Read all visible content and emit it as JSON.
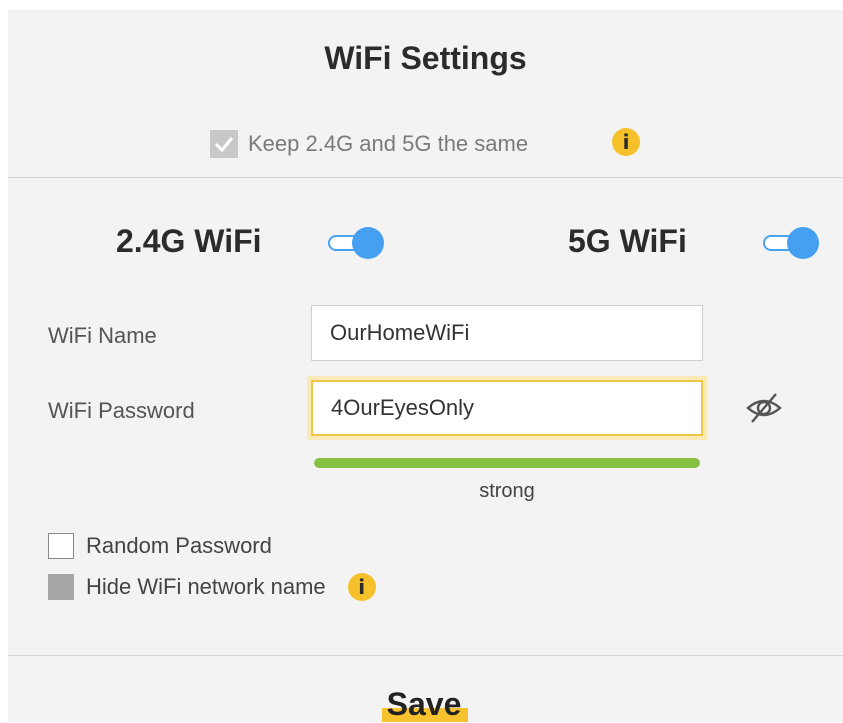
{
  "header": {
    "title": "WiFi Settings"
  },
  "sync": {
    "label": "Keep 2.4G and 5G the same",
    "checked": true,
    "info_icon": "info-icon"
  },
  "bands": {
    "band_24": {
      "label": "2.4G WiFi",
      "enabled": true
    },
    "band_5": {
      "label": "5G WiFi",
      "enabled": true
    }
  },
  "form": {
    "name_label": "WiFi Name",
    "name_value": "OurHomeWiFi",
    "password_label": "WiFi Password",
    "password_value": "4OurEyesOnly",
    "visibility_icon": "eye-slash-icon",
    "strength_label": "strong",
    "strength_level": 1.0,
    "strength_color": "#86c043"
  },
  "options": {
    "random_password": {
      "label": "Random Password",
      "checked": false
    },
    "hide_network": {
      "label": "Hide WiFi network name",
      "checked": true,
      "info_icon": "info-icon"
    }
  },
  "footer": {
    "save_label": "Save"
  },
  "colors": {
    "accent": "#46a0f2",
    "info": "#f5c02a",
    "save_highlight": "#f7c22e",
    "background": "#f3f3f3"
  }
}
